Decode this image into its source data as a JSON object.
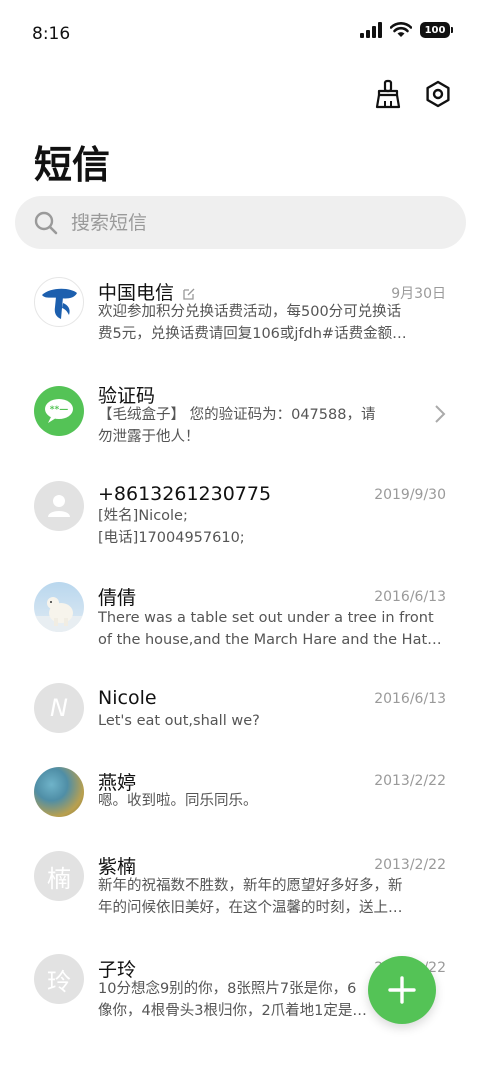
{
  "status_bar": {
    "time": "8:16",
    "battery": "100"
  },
  "header": {
    "title": "短信"
  },
  "search": {
    "placeholder": "搜索短信"
  },
  "conversations": [
    {
      "name": "中国电信",
      "date": "9月30日",
      "line1": "欢迎参加积分兑换话费活动，每500分可兑换话",
      "line2": "费5元，兑换话费请回复106或jfdh#话费金额…"
    },
    {
      "name": "验证码",
      "date": "",
      "line1": "【毛绒盒子】 您的验证码为：047588，请",
      "line2": "勿泄露于他人！"
    },
    {
      "name": "+8613261230775",
      "date": "2019/9/30",
      "line1": "[姓名]Nicole;",
      "line2": "[电话]17004957610;"
    },
    {
      "name": "倩倩",
      "date": "2016/6/13",
      "line1": "There was a table set out under a tree in front",
      "line2": "of the house,and the March Hare and the Hatter…"
    },
    {
      "name": "Nicole",
      "date": "2016/6/13",
      "avatar_letter": "N",
      "line1": "Let's eat out,shall we?",
      "line2": ""
    },
    {
      "name": "燕婷",
      "date": "2013/2/22",
      "line1": "嗯。收到啦。同乐同乐。",
      "line2": ""
    },
    {
      "name": "紫楠",
      "date": "2013/2/22",
      "avatar_letter": "楠",
      "line1": "新年的祝福数不胜数，新年的愿望好多好多，新",
      "line2": "年的问候依旧美好，在这个温馨的时刻，送上…"
    },
    {
      "name": "子玲",
      "date": "2013/2/22",
      "avatar_letter": "玲",
      "line1": "10分想念9别的你，8张照片7张是你，6",
      "line2": "像你，4根骨头3根归你，2爪着地1定是…"
    }
  ],
  "colors": {
    "accent": "#54c356",
    "telecom_blue": "#1c5fae"
  },
  "icons": {
    "clean": "broom-icon",
    "settings": "settings-icon",
    "search": "search-icon",
    "compose": "plus-icon"
  }
}
